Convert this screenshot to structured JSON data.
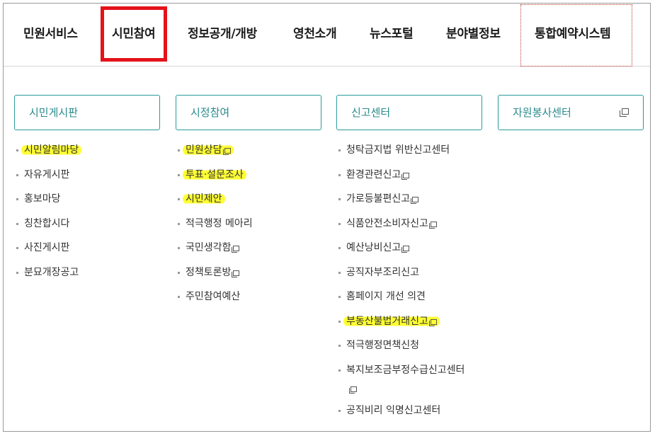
{
  "nav": {
    "items": [
      "민원서비스",
      "시민참여",
      "정보공개/개방",
      "영천소개",
      "뉴스포털",
      "분야별정보",
      "통합예약시스템"
    ],
    "active": "시민참여"
  },
  "columns": [
    {
      "header": "시민게시판",
      "items": [
        {
          "label": "시민알림마당",
          "highlighted": true
        },
        {
          "label": "자유게시판"
        },
        {
          "label": "홍보마당"
        },
        {
          "label": "칭찬합시다"
        },
        {
          "label": "사진게시판"
        },
        {
          "label": "분묘개장공고"
        }
      ]
    },
    {
      "header": "시정참여",
      "items": [
        {
          "label": "민원상담",
          "highlighted": true,
          "external": true
        },
        {
          "label": "투표·설문조사",
          "highlighted": true
        },
        {
          "label": "시민제안",
          "highlighted": true
        },
        {
          "label": "적극행정 메아리"
        },
        {
          "label": "국민생각함",
          "external": true
        },
        {
          "label": "정책토론방",
          "external": true
        },
        {
          "label": "주민참여예산"
        }
      ]
    },
    {
      "header": "신고센터",
      "items": [
        {
          "label": "청탁금지법 위반신고센터"
        },
        {
          "label": "환경관련신고",
          "external": true
        },
        {
          "label": "가로등불편신고",
          "external": true
        },
        {
          "label": "식품안전소비자신고",
          "external": true
        },
        {
          "label": "예산낭비신고",
          "external": true
        },
        {
          "label": "공직자부조리신고"
        },
        {
          "label": "홈페이지 개선 의견"
        },
        {
          "label": "부동산불법거래신고",
          "highlighted": true,
          "external": true
        },
        {
          "label": "적극행정면책신청"
        },
        {
          "label": "복지보조금부정수급신고센터",
          "external": true,
          "wrap_icon": true
        },
        {
          "label": "공직비리 익명신고센터"
        }
      ]
    },
    {
      "header": "자원봉사센터",
      "header_external": true,
      "items": []
    }
  ],
  "colors": {
    "accent_teal": "#2a9a9c",
    "active_border": "#e4131a",
    "highlight": "#ffff33"
  },
  "icons": {
    "external": "new-window-icon"
  }
}
